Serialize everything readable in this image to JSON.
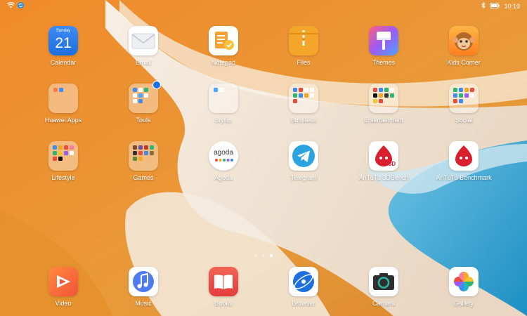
{
  "status_bar": {
    "time": "10:19",
    "icons": [
      "wifi-icon",
      "sync-icon",
      "bluetooth-icon",
      "battery-icon"
    ]
  },
  "apps": {
    "calendar": {
      "label": "Calendar",
      "day_name": "Sunday",
      "day_number": "21"
    },
    "email": {
      "label": "Email"
    },
    "notepad": {
      "label": "Notepad"
    },
    "files": {
      "label": "Files"
    },
    "themes": {
      "label": "Themes"
    },
    "kids_corner": {
      "label": "Kids Corner"
    },
    "huawei_apps": {
      "label": "Huawei Apps"
    },
    "tools": {
      "label": "Tools"
    },
    "stylus": {
      "label": "Stylus"
    },
    "business": {
      "label": "Business"
    },
    "entertainment": {
      "label": "Entertainment"
    },
    "social": {
      "label": "Social"
    },
    "lifestyle": {
      "label": "Lifestyle"
    },
    "games": {
      "label": "Games"
    },
    "agoda": {
      "label": "Agoda",
      "logo_text": "agoda"
    },
    "telegram": {
      "label": "Telegram"
    },
    "antutu_3d": {
      "label": "AnTuTu 3DBench",
      "tag": "3D"
    },
    "antutu": {
      "label": "AnTuTu Benchmark"
    }
  },
  "dock": {
    "video": {
      "label": "Video"
    },
    "music": {
      "label": "Music"
    },
    "books": {
      "label": "Books"
    },
    "browser": {
      "label": "Browser"
    },
    "camera": {
      "label": "Camera"
    },
    "gallery": {
      "label": "Gallery"
    }
  },
  "page_indicator": {
    "pages": 3,
    "current": 3
  },
  "colors": {
    "wallpaper_orange": "#E8892B",
    "wallpaper_cream": "#F1E6D6",
    "wallpaper_blue": "#2E9FD0",
    "notification_badge": "#1A73E8"
  }
}
